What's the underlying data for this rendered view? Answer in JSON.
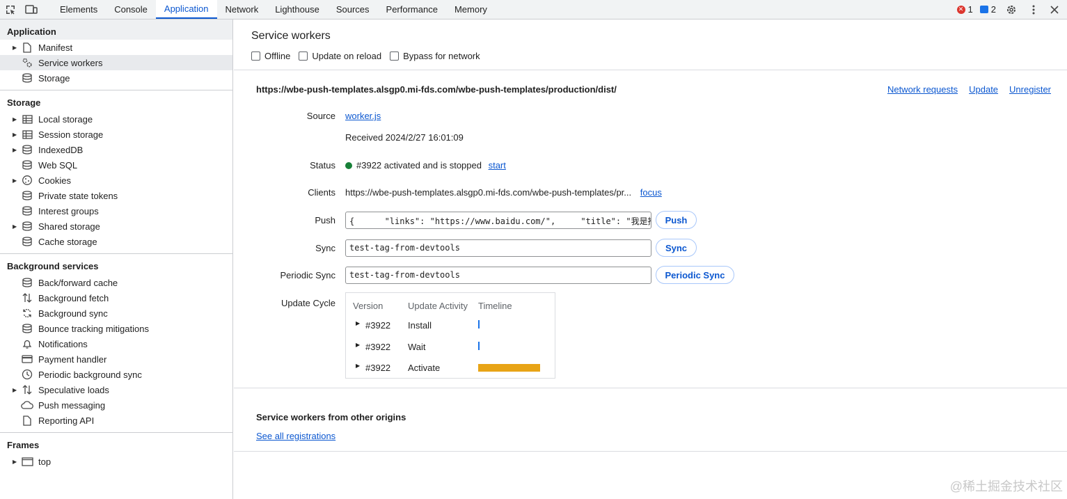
{
  "toolbar": {
    "tabs": [
      "Elements",
      "Console",
      "Application",
      "Network",
      "Lighthouse",
      "Sources",
      "Performance",
      "Memory"
    ],
    "active_tab": "Application",
    "error_count": "1",
    "message_count": "2"
  },
  "sidebar": {
    "application": {
      "title": "Application",
      "items": [
        "Manifest",
        "Service workers",
        "Storage"
      ]
    },
    "storage": {
      "title": "Storage",
      "items": [
        "Local storage",
        "Session storage",
        "IndexedDB",
        "Web SQL",
        "Cookies",
        "Private state tokens",
        "Interest groups",
        "Shared storage",
        "Cache storage"
      ]
    },
    "background": {
      "title": "Background services",
      "items": [
        "Back/forward cache",
        "Background fetch",
        "Background sync",
        "Bounce tracking mitigations",
        "Notifications",
        "Payment handler",
        "Periodic background sync",
        "Speculative loads",
        "Push messaging",
        "Reporting API"
      ]
    },
    "frames": {
      "title": "Frames",
      "items": [
        "top"
      ]
    }
  },
  "main": {
    "title": "Service workers",
    "options": [
      "Offline",
      "Update on reload",
      "Bypass for network"
    ],
    "scope_url": "https://wbe-push-templates.alsgp0.mi-fds.com/wbe-push-templates/production/dist/",
    "scope_links": [
      "Network requests",
      "Update",
      "Unregister"
    ],
    "source_label": "Source",
    "source_file": "worker.js",
    "received": "Received 2024/2/27 16:01:09",
    "status_label": "Status",
    "status_text": "#3922 activated and is stopped",
    "status_action": "start",
    "clients_label": "Clients",
    "clients_url": "https://wbe-push-templates.alsgp0.mi-fds.com/wbe-push-templates/pr...",
    "clients_action": "focus",
    "push_label": "Push",
    "push_value": "{      \"links\": \"https://www.baidu.com/\",     \"title\": \"我是推",
    "push_button": "Push",
    "sync_label": "Sync",
    "sync_value": "test-tag-from-devtools",
    "sync_button": "Sync",
    "periodic_label": "Periodic Sync",
    "periodic_value": "test-tag-from-devtools",
    "periodic_button": "Periodic Sync",
    "cycle_label": "Update Cycle",
    "cycle_headers": [
      "Version",
      "Update Activity",
      "Timeline"
    ],
    "cycle_rows": [
      {
        "version": "#3922",
        "activity": "Install"
      },
      {
        "version": "#3922",
        "activity": "Wait"
      },
      {
        "version": "#3922",
        "activity": "Activate"
      }
    ],
    "other_title": "Service workers from other origins",
    "other_link": "See all registrations"
  },
  "watermark": "@稀土掘金技术社区",
  "colors": {
    "accent": "#0b57d0",
    "status_ok": "#188038",
    "timeline_bar": "#e8a416",
    "error": "#dc362e"
  }
}
